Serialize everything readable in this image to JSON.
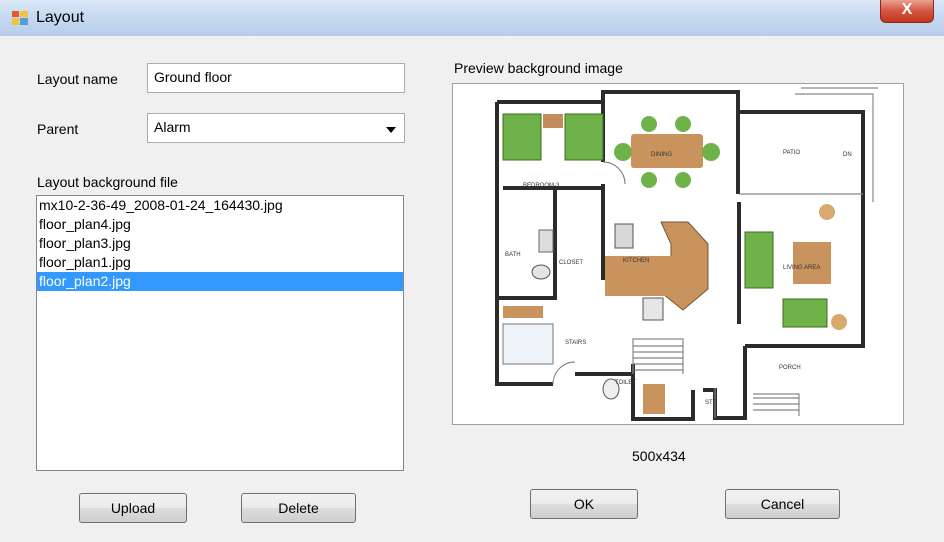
{
  "window": {
    "title": "Layout",
    "close_glyph": "X"
  },
  "form": {
    "layout_name_label": "Layout name",
    "layout_name_value": "Ground floor",
    "parent_label": "Parent",
    "parent_value": "Alarm",
    "background_file_label": "Layout background file",
    "files": [
      "mx10-2-36-49_2008-01-24_164430.jpg",
      "floor_plan4.jpg",
      "floor_plan3.jpg",
      "floor_plan1.jpg",
      "floor_plan2.jpg"
    ],
    "selected_file_index": 4,
    "preview_label": "Preview background image",
    "preview_dimensions": "500x434"
  },
  "floor_plan_labels": {
    "bedroom": "BEDROOM-3",
    "dining": "DINING",
    "patio": "PATIO",
    "bath": "BATH",
    "closet": "CLOSET",
    "kitchen": "KITCHEN",
    "living": "LIVING AREA",
    "stairs": "STAIRS",
    "porch": "PORCH",
    "toilet": "TOILET",
    "stg": "STG",
    "dn": "DN"
  },
  "buttons": {
    "upload": "Upload",
    "delete": "Delete",
    "ok": "OK",
    "cancel": "Cancel"
  },
  "colors": {
    "selection": "#3399ff",
    "titlebar": "#c7daf1",
    "close_button": "#c5341c"
  }
}
